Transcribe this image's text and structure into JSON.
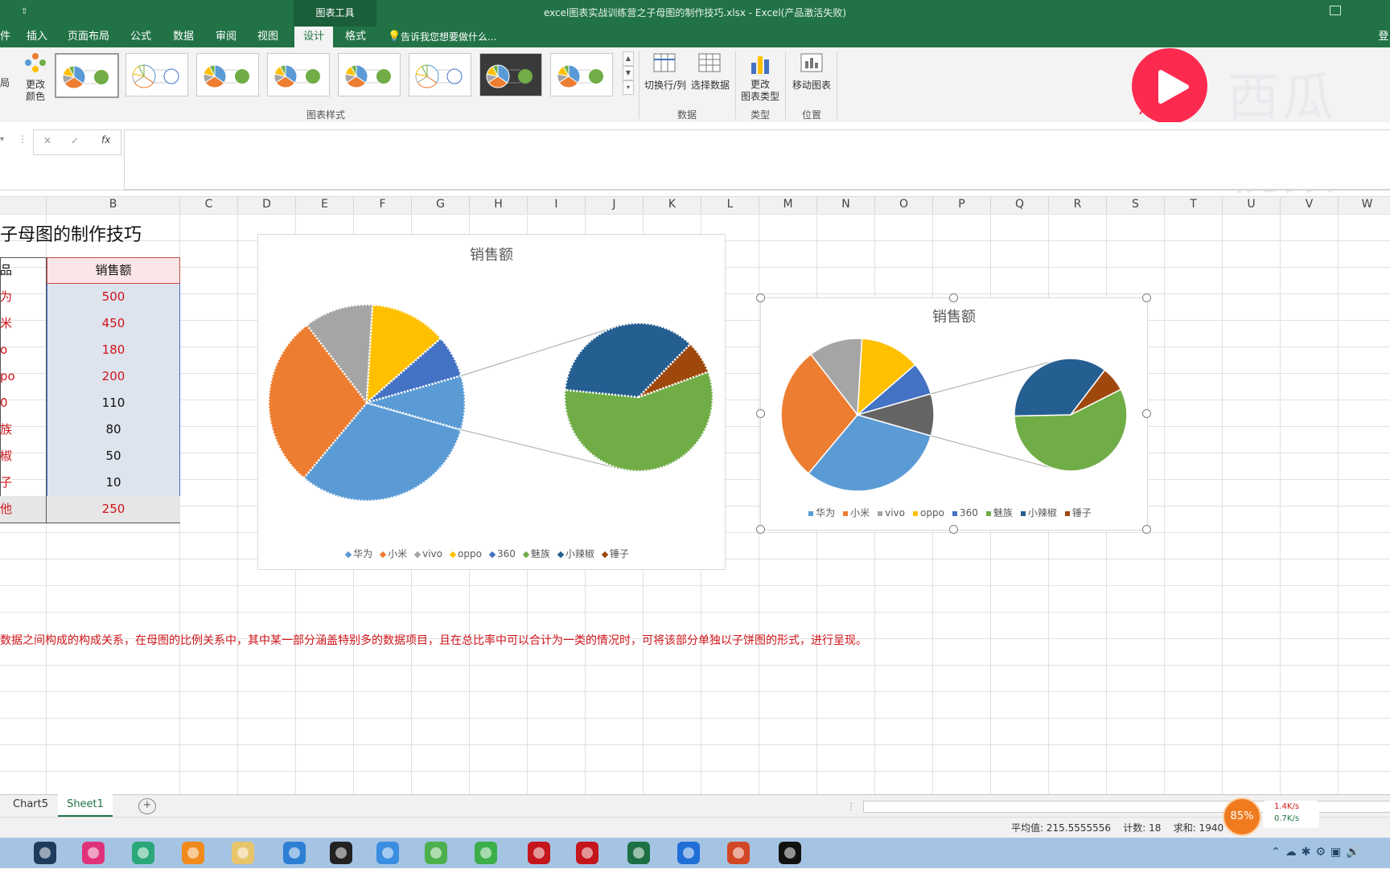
{
  "window": {
    "title": "excel图表实战训练营之子母图的制作技巧.xlsx - Excel(产品激活失败)",
    "contextual_tools": "图表工具",
    "qat_mark": "⇧",
    "login": "登"
  },
  "tabs": {
    "file_fragment": "件",
    "insert": "插入",
    "page_layout": "页面布局",
    "formulas": "公式",
    "data": "数据",
    "review": "审阅",
    "view": "视图",
    "design": "设计",
    "format": "格式",
    "tell_me": "告诉我您想要做什么..."
  },
  "ribbon": {
    "layout_fragment": "局",
    "change_colors": "更改\n颜色",
    "chart_styles_label": "图表样式",
    "switch_row_col": "切换行/列",
    "select_data": "选择数据",
    "data_group_label": "数据",
    "change_chart_type": "更改\n图表类型",
    "type_group_label": "类型",
    "move_chart": "移动图表",
    "location_group_label": "位置"
  },
  "watermark": {
    "text": "西瓜视频"
  },
  "formula_bar": {
    "name_box": "",
    "cancel": "✕",
    "enter": "✓",
    "fx": "fx",
    "value": ""
  },
  "columns": [
    "B",
    "C",
    "D",
    "E",
    "F",
    "G",
    "H",
    "I",
    "J",
    "K",
    "L",
    "M",
    "N",
    "O",
    "P",
    "Q",
    "R",
    "S",
    "T",
    "U",
    "V",
    "W"
  ],
  "sheet": {
    "title": "子母图的制作技巧",
    "header_a": "品",
    "header_b": "销售额",
    "rows": [
      {
        "a": "为",
        "b": "500"
      },
      {
        "a": "米",
        "b": "450"
      },
      {
        "a": "o",
        "b": "180"
      },
      {
        "a": "po",
        "b": "200"
      },
      {
        "a": "0",
        "b": "110"
      },
      {
        "a": "族",
        "b": "80"
      },
      {
        "a": "椒",
        "b": "50"
      },
      {
        "a": "子",
        "b": "10"
      },
      {
        "a": "他",
        "b": "250"
      }
    ],
    "note": "数据之间构成的构成关系，在母图的比例关系中，其中某一部分涵盖特别多的数据项目，且在总比率中可以合计为一类的情况时，可将该部分单独以子饼图的形式，进行呈现。"
  },
  "chart_data": [
    {
      "type": "pie",
      "subtype": "pie-of-pie",
      "title": "销售额",
      "categories": [
        "华为",
        "小米",
        "vivo",
        "oppo",
        "360",
        "魅族",
        "小辣椒",
        "锤子"
      ],
      "values": [
        500,
        450,
        180,
        200,
        110,
        80,
        50,
        10
      ],
      "main_pie": [
        "华为",
        "小米",
        "vivo",
        "oppo",
        "360"
      ],
      "secondary_pie": [
        "魅族",
        "小辣椒",
        "锤子"
      ],
      "legend_position": "bottom",
      "style": "dotted-outline",
      "colors": [
        "#5b9bd5",
        "#ed7d31",
        "#a5a5a5",
        "#ffc000",
        "#4472c4",
        "#70ad47",
        "#255e91",
        "#9e480e"
      ]
    },
    {
      "type": "pie",
      "subtype": "pie-of-pie",
      "title": "销售额",
      "categories": [
        "华为",
        "小米",
        "vivo",
        "oppo",
        "360",
        "魅族",
        "小辣椒",
        "锤子"
      ],
      "values": [
        500,
        450,
        180,
        200,
        110,
        80,
        50,
        10
      ],
      "main_pie": [
        "华为",
        "小米",
        "vivo",
        "oppo",
        "360"
      ],
      "secondary_pie": [
        "魅族",
        "小辣椒",
        "锤子"
      ],
      "legend_position": "bottom",
      "selected": true,
      "colors": [
        "#5b9bd5",
        "#ed7d31",
        "#a5a5a5",
        "#ffc000",
        "#4472c4",
        "#70ad47",
        "#255e91",
        "#9e480e"
      ]
    }
  ],
  "sheet_tabs": {
    "tab1": "Chart5",
    "tab2": "Sheet1",
    "add": "+"
  },
  "status": {
    "average": "平均值: 215.5555556",
    "count": "计数: 18",
    "sum": "求和: 1940",
    "cpu": "85%",
    "up": "1.4K/s",
    "down": "0.7K/s"
  },
  "taskbar_icons": [
    "camera-app",
    "color-app",
    "atom-app",
    "browser-app",
    "file-explorer",
    "ie-browser",
    "video-app",
    "network-app",
    "refresh-app",
    "download-app",
    "solidworks-2016",
    "solidworks-2019",
    "excel-app",
    "bluetooth-app",
    "powerpoint-app",
    "record-app"
  ]
}
